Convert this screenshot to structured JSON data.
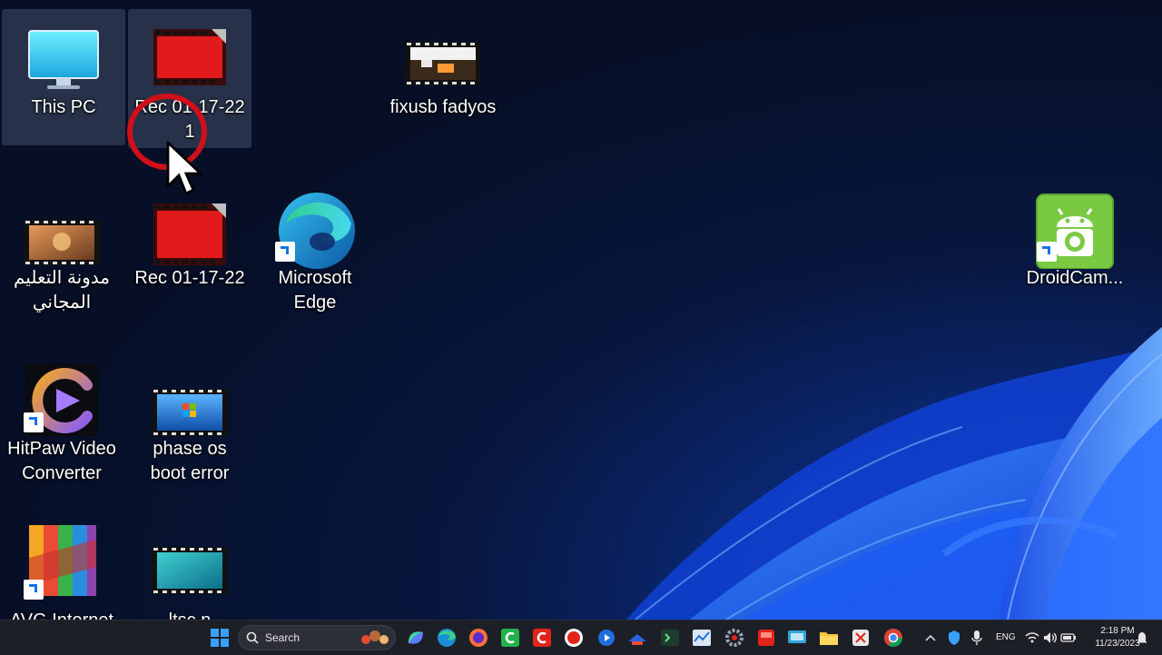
{
  "desktop": {
    "icons": [
      {
        "id": "this-pc",
        "label": "This PC"
      },
      {
        "id": "rec-1",
        "label": "Rec 01-17-22 1"
      },
      {
        "id": "fixusb",
        "label": "fixusb fadyos"
      },
      {
        "id": "arabic-blog",
        "label": "مدونة التعليم المجاني"
      },
      {
        "id": "rec-2",
        "label": "Rec 01-17-22"
      },
      {
        "id": "edge",
        "label": "Microsoft Edge"
      },
      {
        "id": "droidcam",
        "label": "DroidCam..."
      },
      {
        "id": "hitpaw",
        "label": "HitPaw Video Converter"
      },
      {
        "id": "phase-os",
        "label": "phase os boot error"
      },
      {
        "id": "avg",
        "label": "AVG Internet"
      },
      {
        "id": "ltsc",
        "label": "ltsc n"
      }
    ]
  },
  "taskbar": {
    "search_label": "Search",
    "language": "ENG",
    "time": "2:18 PM",
    "date": "11/23/2023"
  },
  "colors": {
    "accent": "#1473e6",
    "cursor_ring": "#d01019",
    "taskbar_bg": "#1c1f26"
  }
}
